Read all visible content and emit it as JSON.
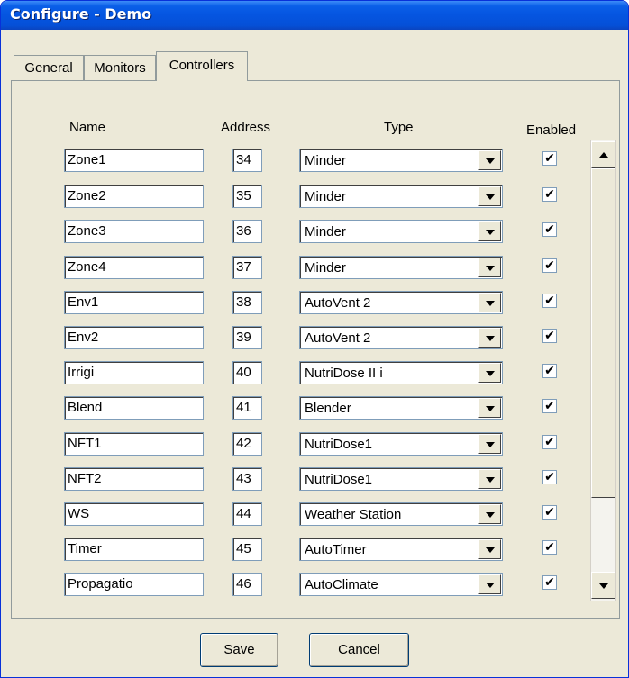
{
  "window": {
    "title": "Configure - Demo"
  },
  "tabs": [
    {
      "label": "General"
    },
    {
      "label": "Monitors"
    },
    {
      "label": "Controllers"
    }
  ],
  "columns": {
    "name": "Name",
    "address": "Address",
    "type": "Type",
    "enabled": "Enabled"
  },
  "controllers": [
    {
      "name": "Zone1",
      "address": "34",
      "type": "Minder",
      "enabled": true
    },
    {
      "name": "Zone2",
      "address": "35",
      "type": "Minder",
      "enabled": true
    },
    {
      "name": "Zone3",
      "address": "36",
      "type": "Minder",
      "enabled": true
    },
    {
      "name": "Zone4",
      "address": "37",
      "type": "Minder",
      "enabled": true
    },
    {
      "name": "Env1",
      "address": "38",
      "type": "AutoVent 2",
      "enabled": true
    },
    {
      "name": "Env2",
      "address": "39",
      "type": "AutoVent 2",
      "enabled": true
    },
    {
      "name": "Irrigi",
      "address": "40",
      "type": "NutriDose II i",
      "enabled": true
    },
    {
      "name": "Blend",
      "address": "41",
      "type": "Blender",
      "enabled": true
    },
    {
      "name": "NFT1",
      "address": "42",
      "type": "NutriDose1",
      "enabled": true
    },
    {
      "name": "NFT2",
      "address": "43",
      "type": "NutriDose1",
      "enabled": true
    },
    {
      "name": "WS",
      "address": "44",
      "type": "Weather Station",
      "enabled": true
    },
    {
      "name": "Timer",
      "address": "45",
      "type": "AutoTimer",
      "enabled": true
    },
    {
      "name": "Propagatio",
      "address": "46",
      "type": "AutoClimate",
      "enabled": true
    }
  ],
  "buttons": {
    "save": "Save",
    "cancel": "Cancel"
  },
  "icons": {
    "scroll_up": "scroll-up-arrow-icon",
    "scroll_down": "scroll-down-arrow-icon",
    "dropdown": "chevron-down-icon",
    "check": "checkmark-icon"
  },
  "colors": {
    "titlebar": "#0555e0",
    "face": "#ece9d8",
    "field_border": "#7f9db9"
  }
}
